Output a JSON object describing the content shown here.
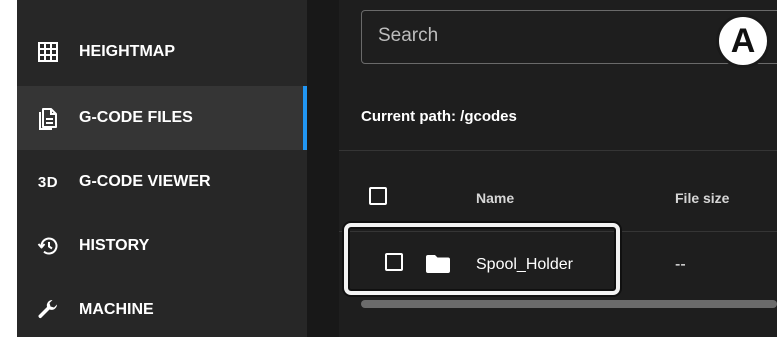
{
  "sidebar": {
    "items": [
      {
        "label": "HEIGHTMAP",
        "icon": "grid-icon"
      },
      {
        "label": "G-CODE FILES",
        "icon": "file-document-icon",
        "active": true
      },
      {
        "label": "G-CODE VIEWER",
        "icon": "3d-icon",
        "icon_text": "3D"
      },
      {
        "label": "HISTORY",
        "icon": "history-icon"
      },
      {
        "label": "MACHINE",
        "icon": "wrench-icon"
      }
    ],
    "active_color": "#2196f3"
  },
  "search": {
    "placeholder": "Search"
  },
  "badge": {
    "label": "A"
  },
  "path": {
    "text": "Current path: /gcodes"
  },
  "table": {
    "headers": {
      "name": "Name",
      "size": "File size"
    },
    "rows": [
      {
        "name": "Spool_Holder",
        "size": "--",
        "icon": "folder-icon"
      }
    ]
  }
}
